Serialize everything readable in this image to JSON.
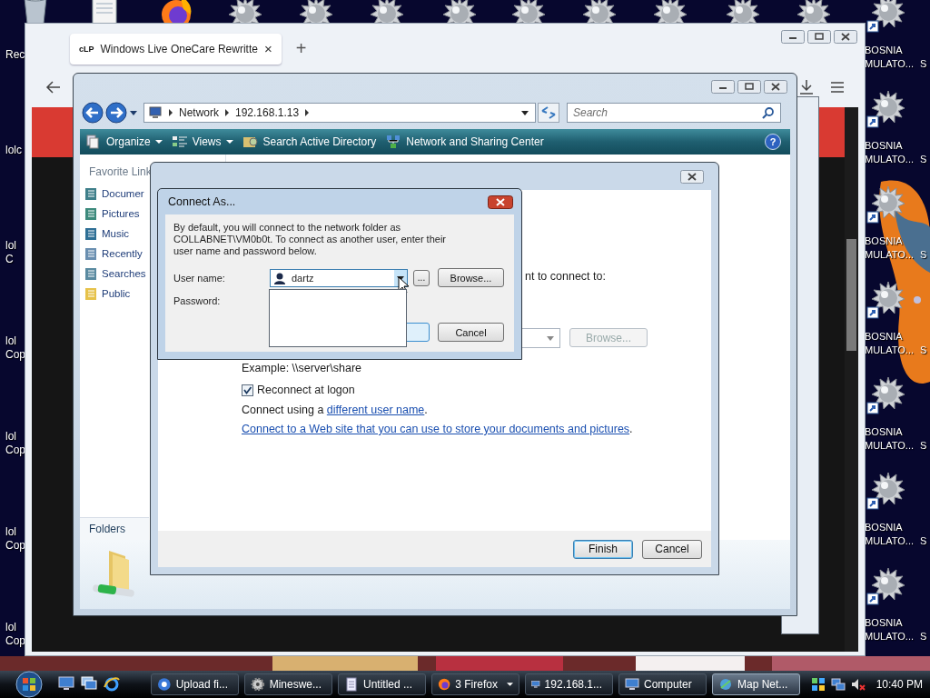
{
  "desktop": {
    "left_labels": [
      {
        "lines": [
          "Rec"
        ]
      },
      {
        "lines": [
          "lolc"
        ]
      },
      {
        "lines": [
          "lol",
          "C"
        ]
      },
      {
        "lines": [
          "lol",
          "Cop"
        ]
      },
      {
        "lines": [
          "lol",
          "Cop"
        ]
      },
      {
        "lines": [
          "lol",
          "Cop"
        ]
      },
      {
        "lines": [
          "lol",
          "Cop"
        ]
      }
    ],
    "right_icons": [
      {
        "lines": [
          "BOSNIA",
          "MULATO..."
        ],
        "fragment": "S"
      },
      {
        "lines": [
          "BOSNIA",
          "MULATO..."
        ],
        "fragment": "S"
      },
      {
        "lines": [
          "BOSNIA",
          "MULATO..."
        ],
        "fragment": "S"
      },
      {
        "lines": [
          "BOSNIA",
          "MULATO..."
        ],
        "fragment": "S"
      },
      {
        "lines": [
          "BOSNIA",
          "MULATO..."
        ],
        "fragment": "S"
      },
      {
        "lines": [
          "BOSNIA",
          "MULATO..."
        ],
        "fragment": "S"
      },
      {
        "lines": [
          "BOSNIA",
          "MULATO..."
        ],
        "fragment": "S"
      }
    ]
  },
  "browser": {
    "tabs": [
      {
        "favicon": "cLP",
        "title": "Windows Live OneCare Rewritte",
        "close": "×",
        "selected": true
      }
    ],
    "new_tab": "+"
  },
  "explorer": {
    "address": [
      "Network",
      "192.168.1.13"
    ],
    "search_placeholder": "Search",
    "toolbar": [
      {
        "label": "Organize",
        "kind": "organize",
        "menu": true
      },
      {
        "label": "Views",
        "kind": "views",
        "menu": true
      },
      {
        "label": "Search Active Directory",
        "kind": "directory",
        "menu": false
      },
      {
        "label": "Network and Sharing Center",
        "kind": "network",
        "menu": false
      }
    ],
    "help": "?",
    "favorites_title": "Favorite Link",
    "favorites": [
      {
        "label": "Documer",
        "kind": "documents"
      },
      {
        "label": "Pictures",
        "kind": "pictures"
      },
      {
        "label": "Music",
        "kind": "music"
      },
      {
        "label": "Recently",
        "kind": "recent"
      },
      {
        "label": "Searches",
        "kind": "searches"
      },
      {
        "label": "Public",
        "kind": "public"
      }
    ],
    "folders": "Folders"
  },
  "wizard": {
    "partial_text": "nt to connect to:",
    "browse": {
      "label": "Browse...",
      "disabled": true
    },
    "example": "Example: \\\\server\\share",
    "reconnect": {
      "label": "Reconnect at logon",
      "checked": true
    },
    "connect_using": {
      "text": "Connect using a ",
      "link": "different user name",
      "tail": "."
    },
    "web_link": {
      "link": "Connect to a Web site that you can use to store your documents and pictures",
      "tail": "."
    },
    "buttons": [
      {
        "label": "Finish",
        "default": true
      },
      {
        "label": "Cancel",
        "default": false
      }
    ]
  },
  "connect_as": {
    "title": "Connect As...",
    "message": "By default, you will connect to the network folder as COLLABNET\\VM0b0t. To connect as another user, enter their user name and password below.",
    "username_label": "User name:",
    "username": "dartz",
    "expanded": true,
    "more": "...",
    "browse": "Browse...",
    "password_label": "Password:",
    "cancel": "Cancel"
  },
  "taskbar": {
    "tasks": [
      {
        "label": "Upload fi...",
        "kind": "chrome",
        "selected": false,
        "group": false
      },
      {
        "label": "Mineswe...",
        "kind": "gear",
        "selected": false,
        "group": false
      },
      {
        "label": "Untitled ...",
        "kind": "notepad",
        "selected": false,
        "group": false
      },
      {
        "label": "3 Firefox",
        "kind": "firefox",
        "selected": false,
        "group": true
      },
      {
        "label": "192.168.1...",
        "kind": "computer",
        "selected": false,
        "group": false
      },
      {
        "label": "Computer",
        "kind": "computer",
        "selected": false,
        "group": false
      },
      {
        "label": "Map Net...",
        "kind": "network",
        "selected": true,
        "group": false
      }
    ],
    "clock": "10:40 PM"
  }
}
